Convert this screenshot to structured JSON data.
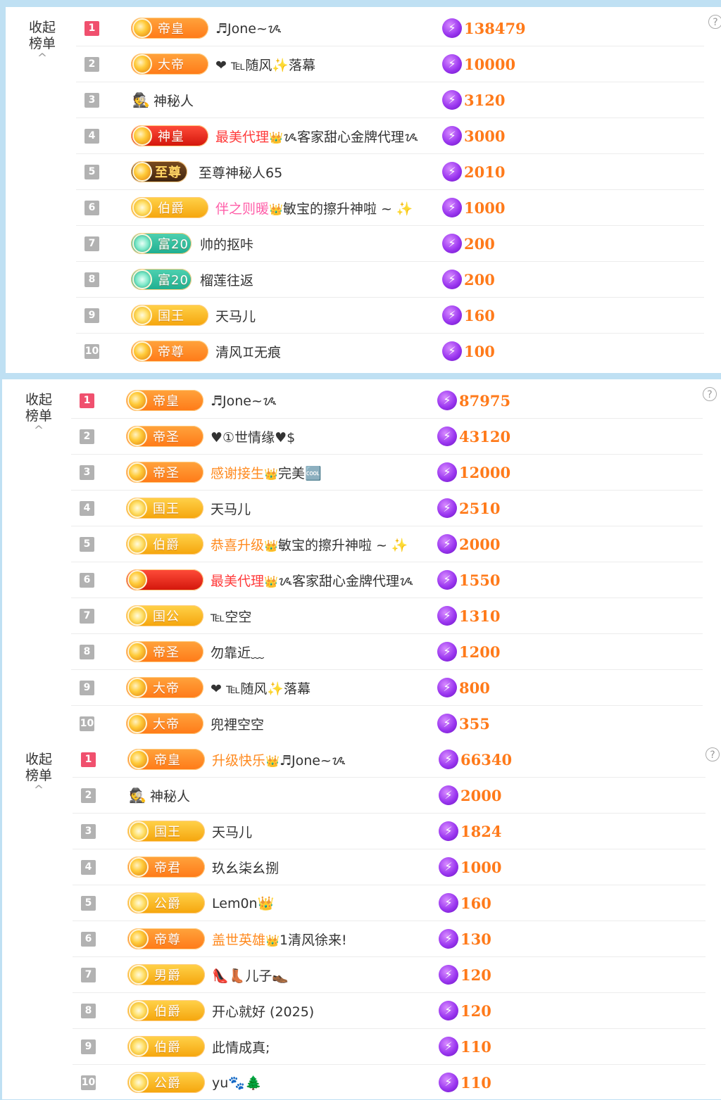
{
  "panels": [
    {
      "collapse_line1": "收起",
      "collapse_line2": "榜单",
      "collapse_chevron": "^",
      "help": "?",
      "rows": [
        {
          "rank": "1",
          "badge": "帝皇",
          "badge_style": "orange",
          "name": "♬Jone~ᝰ",
          "deco": "",
          "score": "138479"
        },
        {
          "rank": "2",
          "badge": "大帝",
          "badge_style": "orange",
          "name": "❤ ℡随风✨落幕",
          "deco": "",
          "score": "10000"
        },
        {
          "rank": "3",
          "badge": "",
          "badge_style": "mystery",
          "name": "神秘人",
          "deco": "",
          "score": "3120"
        },
        {
          "rank": "4",
          "badge": "神皇",
          "badge_style": "red",
          "name": "ᝰ客家甜心金牌代理ᝰ",
          "deco": "最美代理",
          "score": "3000"
        },
        {
          "rank": "5",
          "badge": "至尊",
          "badge_style": "dark",
          "name": "至尊神秘人65",
          "deco": "",
          "score": "2010"
        },
        {
          "rank": "6",
          "badge": "伯爵",
          "badge_style": "gold",
          "name": "敏宝的擦升神啦 ~ ✨",
          "deco": "伴之则暖",
          "score": "1000"
        },
        {
          "rank": "7",
          "badge": "富20",
          "badge_style": "teal",
          "name": "帅的抠咔",
          "deco": "",
          "score": "200"
        },
        {
          "rank": "8",
          "badge": "富20",
          "badge_style": "teal",
          "name": "榴莲往返",
          "deco": "",
          "score": "200"
        },
        {
          "rank": "9",
          "badge": "国王",
          "badge_style": "gold",
          "name": "天马儿",
          "deco": "",
          "score": "160"
        },
        {
          "rank": "10",
          "badge": "帝尊",
          "badge_style": "orange",
          "name": "清风♊无痕",
          "deco": "",
          "score": "100"
        }
      ]
    },
    {
      "collapse_line1": "收起",
      "collapse_line2": "榜单",
      "collapse_chevron": "^",
      "help": "?",
      "rows": [
        {
          "rank": "1",
          "badge": "帝皇",
          "badge_style": "orange",
          "name": "♬Jone~ᝰ",
          "deco": "",
          "score": "87975"
        },
        {
          "rank": "2",
          "badge": "帝圣",
          "badge_style": "orange",
          "name": "♥①世情缘♥$",
          "deco": "",
          "score": "43120"
        },
        {
          "rank": "3",
          "badge": "帝圣",
          "badge_style": "orange",
          "name": "完美🆒",
          "deco": "感谢接生",
          "score": "12000"
        },
        {
          "rank": "4",
          "badge": "国王",
          "badge_style": "gold",
          "name": "天马儿",
          "deco": "",
          "score": "2510"
        },
        {
          "rank": "5",
          "badge": "伯爵",
          "badge_style": "gold",
          "name": "敏宝的擦升神啦 ~ ✨",
          "deco": "恭喜升级",
          "score": "2000"
        },
        {
          "rank": "6",
          "badge": "",
          "badge_style": "red",
          "name": "ᝰ客家甜心金牌代理ᝰ",
          "deco": "最美代理",
          "score": "1550"
        },
        {
          "rank": "7",
          "badge": "国公",
          "badge_style": "gold",
          "name": "℡空空",
          "deco": "",
          "score": "1310"
        },
        {
          "rank": "8",
          "badge": "帝圣",
          "badge_style": "orange",
          "name": "勿靠近﹏",
          "deco": "",
          "score": "1200"
        },
        {
          "rank": "9",
          "badge": "大帝",
          "badge_style": "orange",
          "name": "❤ ℡随风✨落幕",
          "deco": "",
          "score": "800"
        },
        {
          "rank": "10",
          "badge": "大帝",
          "badge_style": "orange",
          "name": "兜裡空空",
          "deco": "",
          "score": "355"
        }
      ]
    },
    {
      "collapse_line1": "收起",
      "collapse_line2": "榜单",
      "collapse_chevron": "^",
      "help": "?",
      "rows": [
        {
          "rank": "1",
          "badge": "帝皇",
          "badge_style": "orange",
          "name": "♬Jone~ᝰ",
          "deco": "升级快乐",
          "score": "66340"
        },
        {
          "rank": "2",
          "badge": "",
          "badge_style": "mystery",
          "name": "神秘人",
          "deco": "",
          "score": "2000"
        },
        {
          "rank": "3",
          "badge": "国王",
          "badge_style": "gold",
          "name": "天马儿",
          "deco": "",
          "score": "1824"
        },
        {
          "rank": "4",
          "badge": "帝君",
          "badge_style": "orange",
          "name": "玖幺柒幺捌",
          "deco": "",
          "score": "1000"
        },
        {
          "rank": "5",
          "badge": "公爵",
          "badge_style": "gold",
          "name": "Lem0n👑",
          "deco": "",
          "score": "160"
        },
        {
          "rank": "6",
          "badge": "帝尊",
          "badge_style": "orange",
          "name": "1清风徐来!",
          "deco": "盖世英雄",
          "score": "130"
        },
        {
          "rank": "7",
          "badge": "男爵",
          "badge_style": "gold",
          "name": "👠👢儿子👞",
          "deco": "",
          "score": "120"
        },
        {
          "rank": "8",
          "badge": "伯爵",
          "badge_style": "gold",
          "name": "开心就好 (2025)",
          "deco": "",
          "score": "120"
        },
        {
          "rank": "9",
          "badge": "伯爵",
          "badge_style": "gold",
          "name": "此情成真;",
          "deco": "",
          "score": "110"
        },
        {
          "rank": "10",
          "badge": "公爵",
          "badge_style": "gold",
          "name": "yu🐾🌲",
          "deco": "",
          "score": "110"
        }
      ]
    }
  ],
  "colors": {
    "rank_top": "#f0506e",
    "rank_default": "#b2b2b2",
    "score_text": "#ff7a1a",
    "score_icon": "#9b37f0",
    "background": "#bfe0f3"
  },
  "icons": {
    "score": "lightning-bolt-icon",
    "mystery": "mystery-person-icon",
    "help": "question-circle-icon",
    "collapse": "chevron-up-icon"
  }
}
